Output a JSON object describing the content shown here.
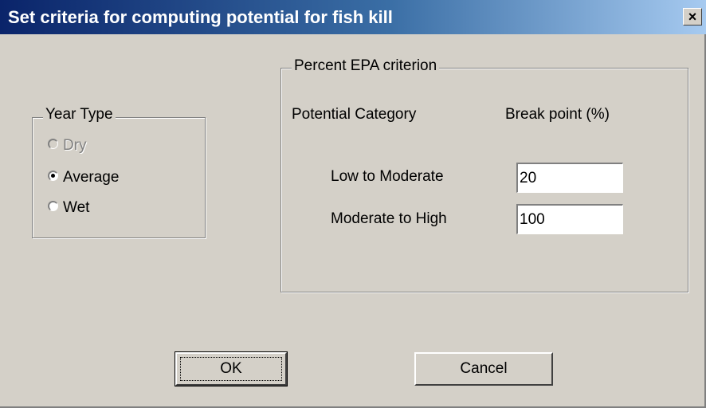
{
  "window": {
    "title": "Set criteria for computing potential for fish kill",
    "close_glyph": "×"
  },
  "year_type": {
    "label": "Year Type",
    "options": [
      {
        "label": "Dry",
        "selected": false,
        "enabled": false
      },
      {
        "label": "Average",
        "selected": true,
        "enabled": true
      },
      {
        "label": "Wet",
        "selected": false,
        "enabled": true
      }
    ]
  },
  "epa": {
    "label": "Percent EPA criterion",
    "col_category": "Potential Category",
    "col_breakpoint": "Break point (%)",
    "rows": [
      {
        "label": "Low to Moderate",
        "value": "20"
      },
      {
        "label": "Moderate to High",
        "value": "100"
      }
    ]
  },
  "buttons": {
    "ok": "OK",
    "cancel": "Cancel"
  }
}
